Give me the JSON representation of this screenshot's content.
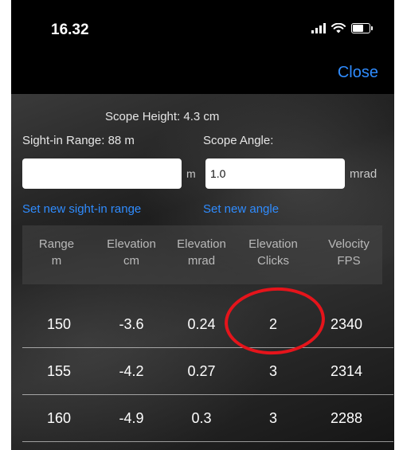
{
  "status": {
    "time": "16.32"
  },
  "nav": {
    "close_label": "Close"
  },
  "form": {
    "scope_height_label": "Scope Height: 4.3 cm",
    "sight_in_range_label": "Sight-in Range: 88 m",
    "scope_angle_label": "Scope Angle:",
    "range_value": "",
    "range_unit": "m",
    "angle_value": "1.0",
    "angle_unit": "mrad",
    "set_range_link": "Set new sight-in range",
    "set_angle_link": "Set new angle"
  },
  "table": {
    "headers": [
      {
        "line1": "Range",
        "line2": "m"
      },
      {
        "line1": "Elevation",
        "line2": "cm"
      },
      {
        "line1": "Elevation",
        "line2": "mrad"
      },
      {
        "line1": "Elevation",
        "line2": "Clicks"
      },
      {
        "line1": "Velocity",
        "line2": "FPS"
      }
    ],
    "rows": [
      [
        "150",
        "-3.6",
        "0.24",
        "2",
        "2340"
      ],
      [
        "155",
        "-4.2",
        "0.27",
        "3",
        "2314"
      ],
      [
        "160",
        "-4.9",
        "0.3",
        "3",
        "2288"
      ]
    ]
  },
  "colors": {
    "accent": "#2f8cff",
    "highlight": "#e5141b",
    "background": "#000000"
  }
}
